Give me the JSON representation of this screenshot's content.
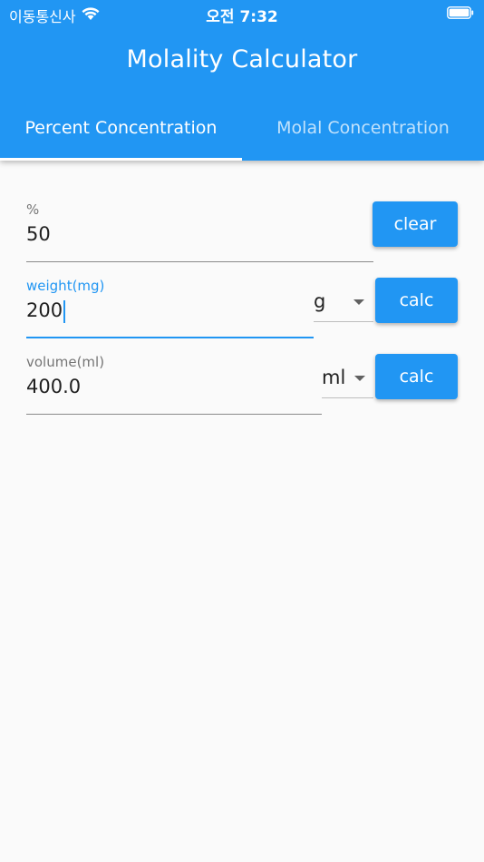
{
  "status_bar": {
    "carrier": "이동통신사",
    "time": "오전 7:32"
  },
  "app_bar": {
    "title": "Molality Calculator"
  },
  "tabs": [
    {
      "label": "Percent Concentration",
      "selected": true
    },
    {
      "label": "Molal Concentration",
      "selected": false
    }
  ],
  "form": {
    "percent": {
      "label": "%",
      "value": "50"
    },
    "weight": {
      "label": "weight(mg)",
      "value": "200",
      "unit": "g"
    },
    "volume": {
      "label": "volume(ml)",
      "value": "400.0",
      "unit": "ml"
    },
    "clear_label": "clear",
    "calc_label": "calc"
  },
  "colors": {
    "primary": "#2196f3",
    "background": "#fafafa"
  }
}
